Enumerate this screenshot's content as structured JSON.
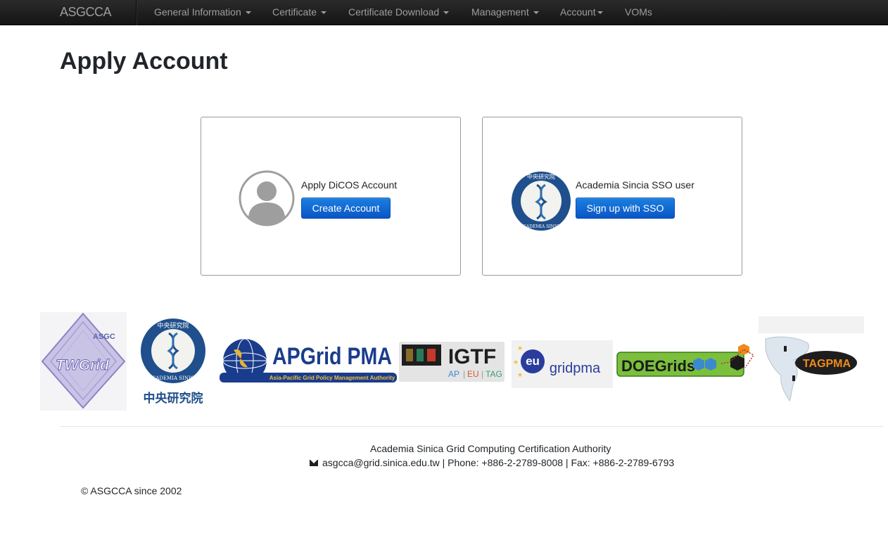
{
  "navbar": {
    "brand": "ASGCCA",
    "items": [
      {
        "label": "General Information"
      },
      {
        "label": "Certificate"
      },
      {
        "label": "Certificate Download"
      },
      {
        "label": "Management"
      },
      {
        "label": "Account"
      },
      {
        "label": "VOMs"
      }
    ]
  },
  "page": {
    "title": "Apply Account"
  },
  "cards": [
    {
      "text": "Apply DiCOS Account",
      "button": "Create Account",
      "icon": "user-avatar-icon"
    },
    {
      "text": "Academia Sincia SSO user",
      "button": "Sign up with SSO",
      "icon": "academia-sinica-seal-icon"
    }
  ],
  "logos": {
    "twgrid": {
      "top": "ASGC",
      "main": "TWGrid"
    },
    "sinica": {
      "chinese": "中央研究院",
      "ring": "ACADEMIA SINICA"
    },
    "apgrid": {
      "main": "APGrid PMA",
      "sub": "Asia-Pacific Grid Policy Management Authority"
    },
    "igtf": {
      "main": "IGTF",
      "sub1": "AP",
      "sub2": "EU",
      "sub3": "TAG"
    },
    "eugrid": {
      "eu": "eu",
      "main": "gridpma"
    },
    "doegrids": {
      "main": "DOEGrids"
    },
    "tagpma": {
      "main": "TAGPMA"
    }
  },
  "footer": {
    "org": "Academia Sinica Grid Computing Certification Authority",
    "email": "asgcca@grid.sinica.edu.tw",
    "contact": " | Phone: +886-2-2789-8008 | Fax: +886-2-2789-6793",
    "copyright": "© ASGCCA since 2002"
  },
  "colors": {
    "navbar": "#1c1c1c",
    "button": "#0a63d4",
    "nav_text": "#9d9d9d"
  }
}
